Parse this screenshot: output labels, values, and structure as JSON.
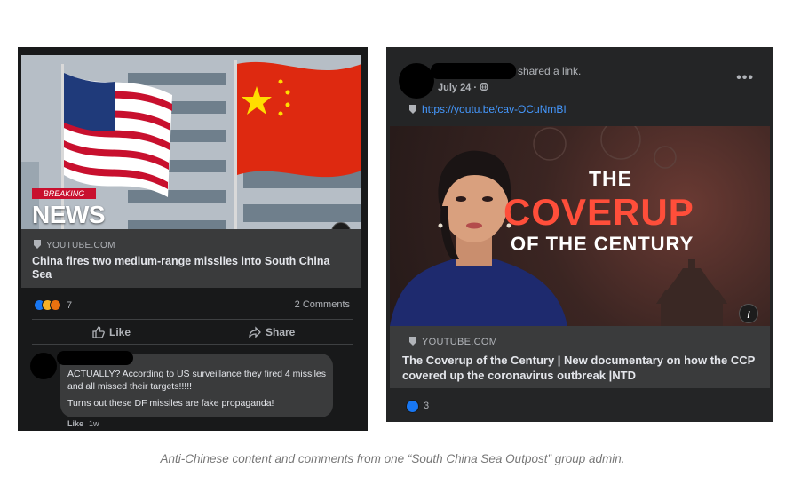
{
  "left_post": {
    "thumbnail": {
      "breaking_tag": "BREAKING",
      "news_word": "NEWS"
    },
    "link_source": "YOUTUBE.COM",
    "link_title": "China fires two medium-range missiles into South China Sea",
    "reaction_count": "7",
    "comments_label": "2 Comments",
    "like_label": "Like",
    "share_label": "Share",
    "comment": {
      "line1": "ACTUALLY? According to US surveillance they fired 4 missiles and all missed their targets!!!!!",
      "line2": "Turns out these DF missiles are fake propaganda!",
      "action": "Like",
      "time": "1w"
    },
    "info_glyph": "i"
  },
  "right_post": {
    "shared_text": "shared a link.",
    "date": "July 24 ·",
    "more_glyph": "•••",
    "link_url": "https://youtu.be/cav-OCuNmBI",
    "thumbnail": {
      "line1": "THE",
      "line2": "COVERUP",
      "line3": "OF THE CENTURY"
    },
    "link_source": "YOUTUBE.COM",
    "link_title": "The Coverup of the Century | New documentary on how the CCP covered up the coronavirus outbreak |NTD",
    "reaction_count": "3",
    "info_glyph": "i"
  },
  "caption": "Anti-Chinese content and comments from one “South China Sea Outpost” group admin.",
  "colors": {
    "fb_dark": "#18191a",
    "card": "#3a3b3c",
    "link_blue": "#4599ff",
    "coverup_red": "#ff4e3a"
  }
}
